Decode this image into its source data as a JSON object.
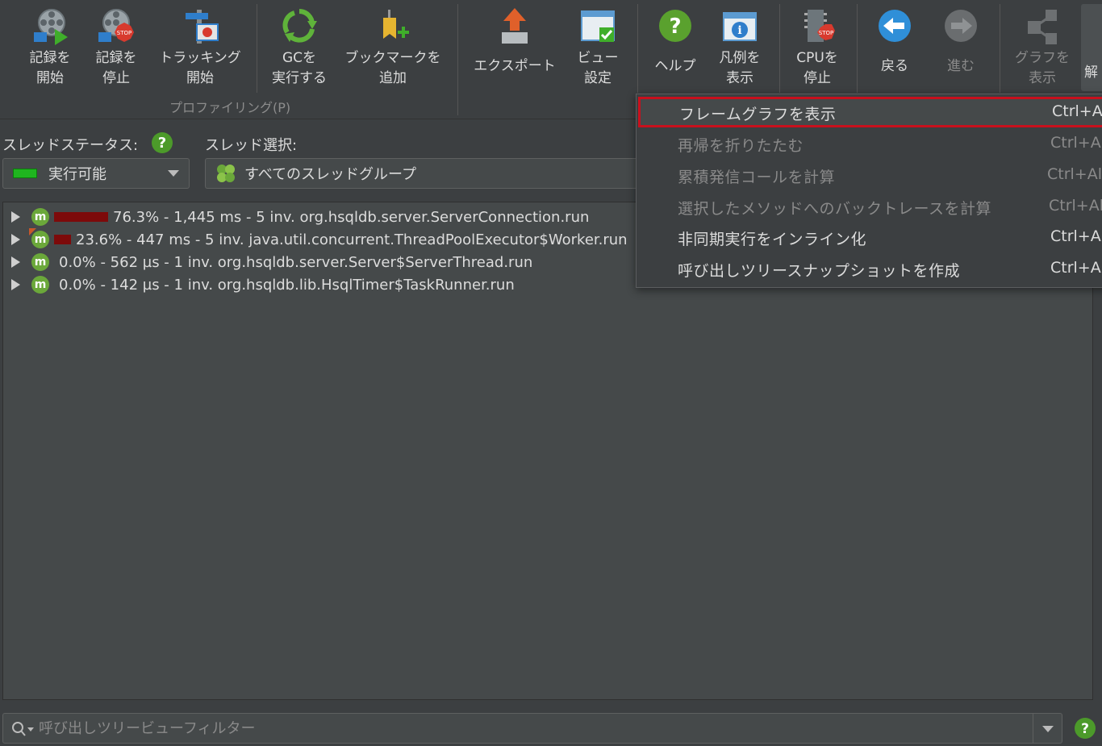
{
  "toolbar": {
    "buttons": [
      {
        "label": "記録を\n開始",
        "icon": "start-recording-icon"
      },
      {
        "label": "記録を\n停止",
        "icon": "stop-recording-icon"
      },
      {
        "label": "トラッキング\n開始",
        "icon": "start-tracking-icon"
      },
      {
        "label": "GCを\n実行する",
        "icon": "run-gc-icon"
      },
      {
        "label": "ブックマークを\n追加",
        "icon": "add-bookmark-icon"
      },
      {
        "label": "エクスポート",
        "icon": "export-icon"
      },
      {
        "label": "ビュー\n設定",
        "icon": "view-settings-icon"
      },
      {
        "label": "ヘルプ",
        "icon": "help-icon"
      },
      {
        "label": "凡例を\n表示",
        "icon": "show-legend-icon"
      },
      {
        "label": "CPUを\n停止",
        "icon": "stop-cpu-icon"
      },
      {
        "label": "戻る",
        "icon": "back-icon"
      },
      {
        "label": "進む",
        "icon": "forward-icon"
      },
      {
        "label": "グラフを\n表示",
        "icon": "show-graph-icon"
      }
    ],
    "group_label": "プロファイリング(P)",
    "overflow_label": "解"
  },
  "filters": {
    "thread_status_label": "スレッドステータス:",
    "thread_status_value": "実行可能",
    "thread_select_label": "スレッド選択:",
    "thread_select_value": "すべてのスレッドグループ"
  },
  "tree": {
    "rows": [
      {
        "text": "76.3% - 1,445 ms - 5 inv. org.hsqldb.server.ServerConnection.run",
        "bar_fraction": 0.763
      },
      {
        "text": "23.6% - 447 ms - 5 inv. java.util.concurrent.ThreadPoolExecutor$Worker.run",
        "bar_fraction": 0.236
      },
      {
        "text": "0.0% - 562 µs - 1 inv. org.hsqldb.server.Server$ServerThread.run",
        "bar_fraction": 0
      },
      {
        "text": "0.0% - 142 µs - 1 inv. org.hsqldb.lib.HsqlTimer$TaskRunner.run",
        "bar_fraction": 0
      }
    ]
  },
  "filter_bar": {
    "placeholder": "呼び出しツリービューフィルター"
  },
  "context_menu": {
    "items": [
      {
        "label": "フレームグラフを表示",
        "shortcut": "Ctrl+Al",
        "enabled": true,
        "selected": true
      },
      {
        "label": "再帰を折りたたむ",
        "shortcut": "Ctrl+Al",
        "enabled": false
      },
      {
        "label": "累積発信コールを計算",
        "shortcut": "Ctrl+Al",
        "enabled": false
      },
      {
        "label": "選択したメソッドへのバックトレースを計算",
        "shortcut": "Ctrl+Al",
        "enabled": false
      },
      {
        "label": "非同期実行をインライン化",
        "shortcut": "Ctrl+Al",
        "enabled": true
      },
      {
        "label": "呼び出しツリースナップショットを作成",
        "shortcut": "Ctrl+Al",
        "enabled": true
      }
    ]
  },
  "colors": {
    "background": "#3c3f41",
    "panel": "#45494a",
    "bar": "#7d0a0a",
    "highlight_border": "#c8101d",
    "status_green": "#1fb51f",
    "help_green": "#4c9a2a"
  }
}
